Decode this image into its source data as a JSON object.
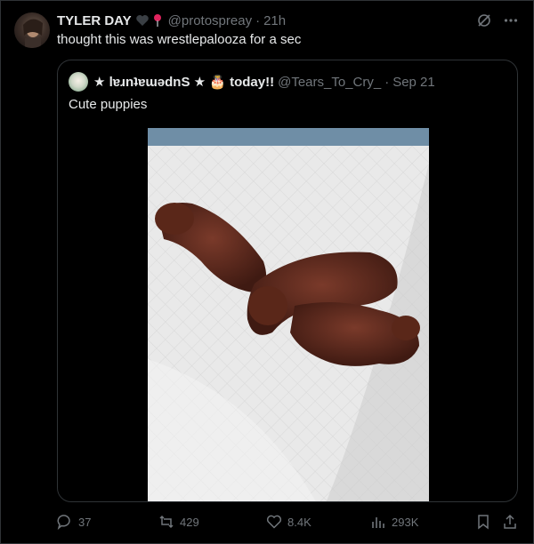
{
  "tweet": {
    "author": {
      "name": "TYLER DAY",
      "handle": "@protospreay",
      "time": "21h"
    },
    "text": "thought this was wrestlepalooza for a sec"
  },
  "quote": {
    "author": {
      "name": "★ lɐɹnʇɐɯǝdnS ★ 🎂 today!!",
      "handle": "@Tears_To_Cry_",
      "date": "Sep 21"
    },
    "text": "Cute puppies",
    "image_description_icon": "puppies-photo"
  },
  "actions": {
    "replies": "37",
    "reposts": "429",
    "likes": "8.4K",
    "views": "293K"
  },
  "colors": {
    "background": "#000000",
    "text": "#e7e9ea",
    "muted": "#71767b",
    "border": "#2f3336"
  }
}
